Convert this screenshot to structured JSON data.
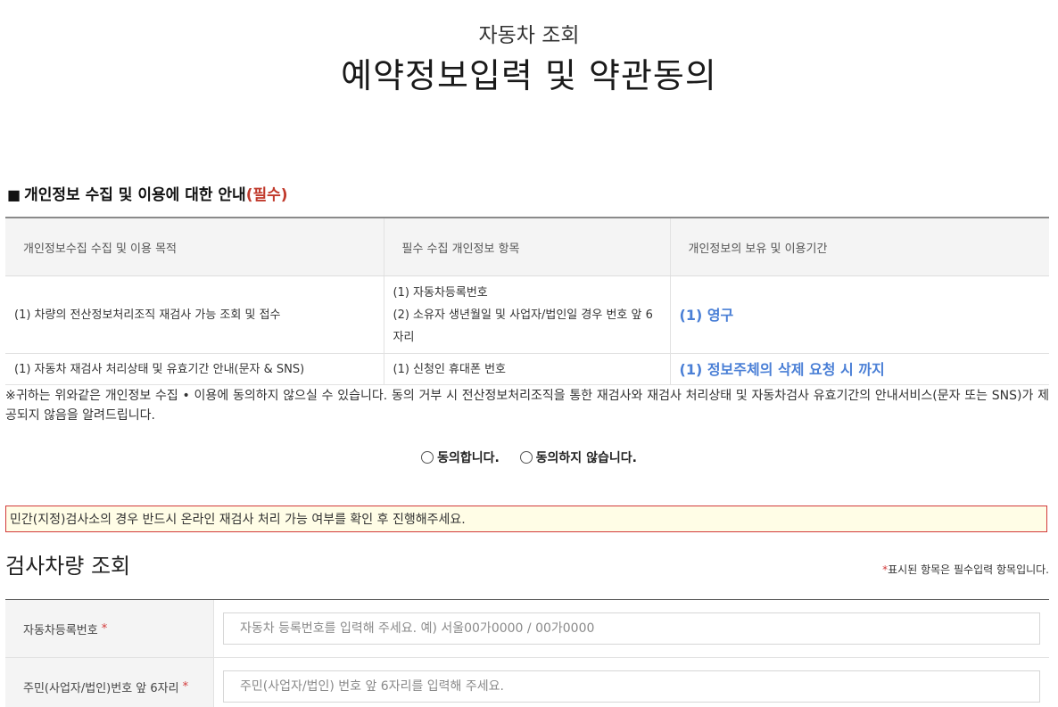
{
  "header": {
    "subtitle": "자동차 조회",
    "title": "예약정보입력 및 약관동의"
  },
  "privacy_section": {
    "square": "■",
    "heading": "개인정보 수집 및 이용에 대한 안내",
    "required_tag": "(필수)",
    "columns": [
      "개인정보수집 수집 및 이용 목적",
      "필수 수집 개인정보 항목",
      "개인정보의 보유 및 이용기간"
    ],
    "rows": [
      {
        "purpose": "(1) 차량의 전산정보처리조직 재검사 가능 조회 및 접수",
        "items": [
          "(1) 자동차등록번호",
          "(2) 소유자 생년월일 및 사업자/법인일 경우 번호 앞 6자리"
        ],
        "period": "(1) 영구"
      },
      {
        "purpose": "(1) 자동차 재검사 처리상태 및 유효기간 안내(문자 & SNS)",
        "items": [
          "(1) 신청인 휴대폰 번호"
        ],
        "period": "(1) 정보주체의 삭제 요청 시 까지"
      }
    ],
    "notice": "※귀하는 위와같은 개인정보 수집 • 이용에 동의하지 않으실 수 있습니다. 동의 거부 시 전산정보처리조직을 통한 재검사와 재검사 처리상태 및 자동차검사 유효기간의 안내서비스(문자 또는 SNS)가 제공되지 않음을 알려드립니다."
  },
  "consent": {
    "agree": "동의합니다.",
    "disagree": "동의하지 않습니다."
  },
  "alert": "민간(지정)검사소의 경우 반드시 온라인 재검사 처리 가능 여부를 확인 후 진행해주세요.",
  "lookup": {
    "title": "검사차량 조회",
    "required_note_star": "*",
    "required_note": "표시된 항목은 필수입력 항목입니다.",
    "fields": [
      {
        "label": "자동차등록번호",
        "star": "*",
        "placeholder": "자동차 등록번호를 입력해 주세요. 예) 서울00가0000 / 00가0000",
        "value": ""
      },
      {
        "label": "주민(사업자/법인)번호 앞 6자리",
        "star": "*",
        "placeholder": "주민(사업자/법인) 번호 앞 6자리를 입력해 주세요.",
        "value": ""
      }
    ]
  },
  "colors": {
    "accent_blue": "#4a7fd6",
    "required_red": "#d23a3a",
    "alert_bg": "#fffde6"
  }
}
